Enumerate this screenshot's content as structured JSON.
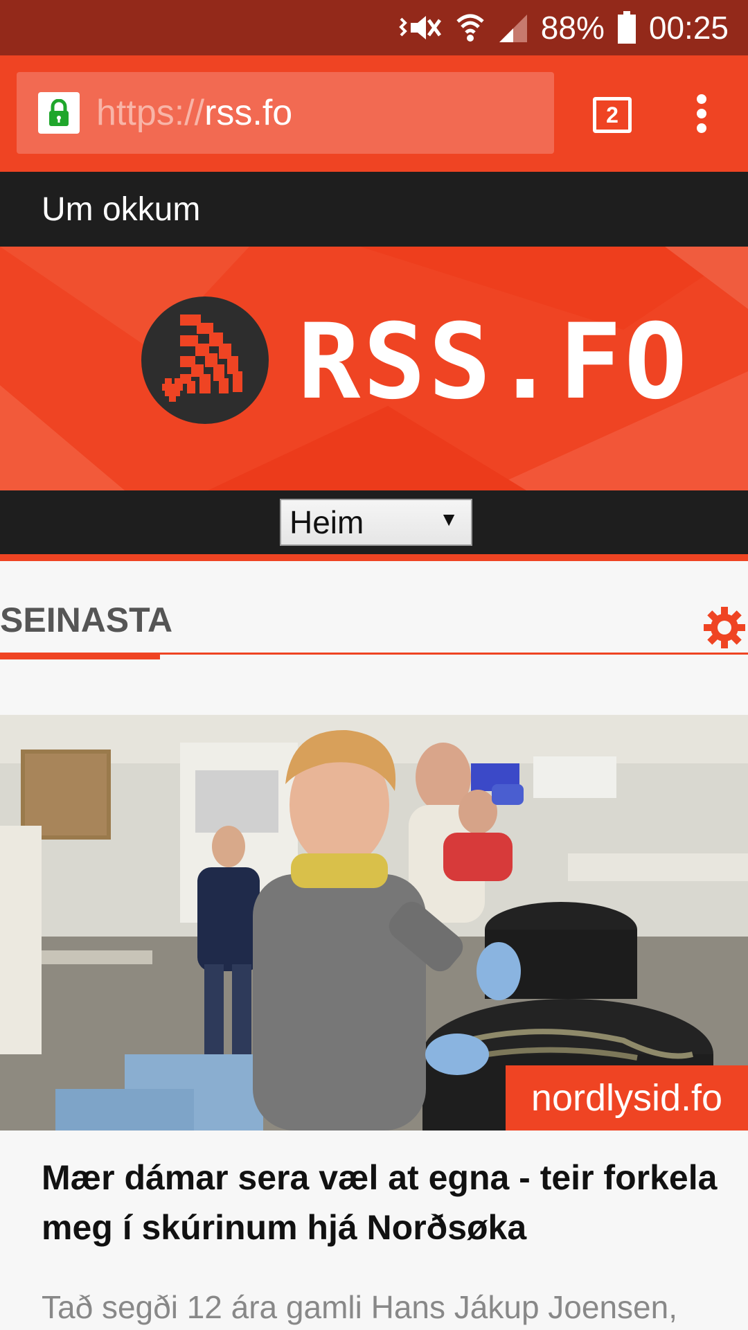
{
  "status_bar": {
    "battery": "88%",
    "time": "00:25",
    "icons": [
      "vibrate-mute-icon",
      "wifi-icon",
      "signal-icon",
      "battery-icon"
    ]
  },
  "browser": {
    "url_scheme": "https://",
    "url_host": "rss.fo",
    "tab_count": "2",
    "icons": [
      "lock-icon",
      "tabs-icon",
      "overflow-menu-icon"
    ]
  },
  "nav": {
    "about_label": "Um okkum"
  },
  "banner": {
    "logo_text": "RSS.FO",
    "icons": [
      "rss-heart-logo-icon"
    ]
  },
  "menu_select": {
    "selected": "Heim"
  },
  "section": {
    "title": "SEINASTA",
    "icons": [
      "gear-icon"
    ]
  },
  "article": {
    "photo_credit": "nordlysid.fo",
    "title": "Mær dámar sera væl at egna - teir forkela meg í skúrinum hjá Norðsøka",
    "lead": "Tað segði 12 ára gamli Hans Jákup Joensen,"
  },
  "colors": {
    "accent": "#ef4423",
    "status_bar": "#93291a",
    "nav_dark": "#1e1e1e"
  }
}
